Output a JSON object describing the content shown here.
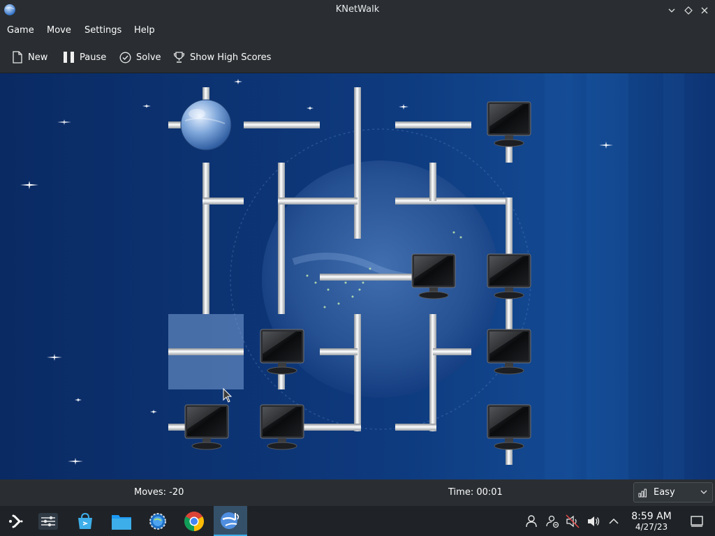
{
  "window": {
    "title": "KNetWalk"
  },
  "menu": {
    "items": [
      "Game",
      "Move",
      "Settings",
      "Help"
    ]
  },
  "toolbar": {
    "new_label": "New",
    "pause_label": "Pause",
    "solve_label": "Solve",
    "highscores_label": "Show High Scores"
  },
  "status": {
    "moves": "Moves: -20",
    "time": "Time: 00:01",
    "difficulty": "Easy"
  },
  "taskbar": {
    "apps": [
      "application-launcher-icon",
      "system-settings-icon",
      "discover-store-icon",
      "file-manager-icon",
      "knetwalk-icon",
      "chrome-icon",
      "knetwalk-active-icon"
    ],
    "clock_time": "8:59 AM",
    "clock_date": "4/27/23"
  },
  "colors": {
    "accent": "#3daee9",
    "board_bg": "#0c2f6b",
    "panel": "#2a2e32"
  }
}
